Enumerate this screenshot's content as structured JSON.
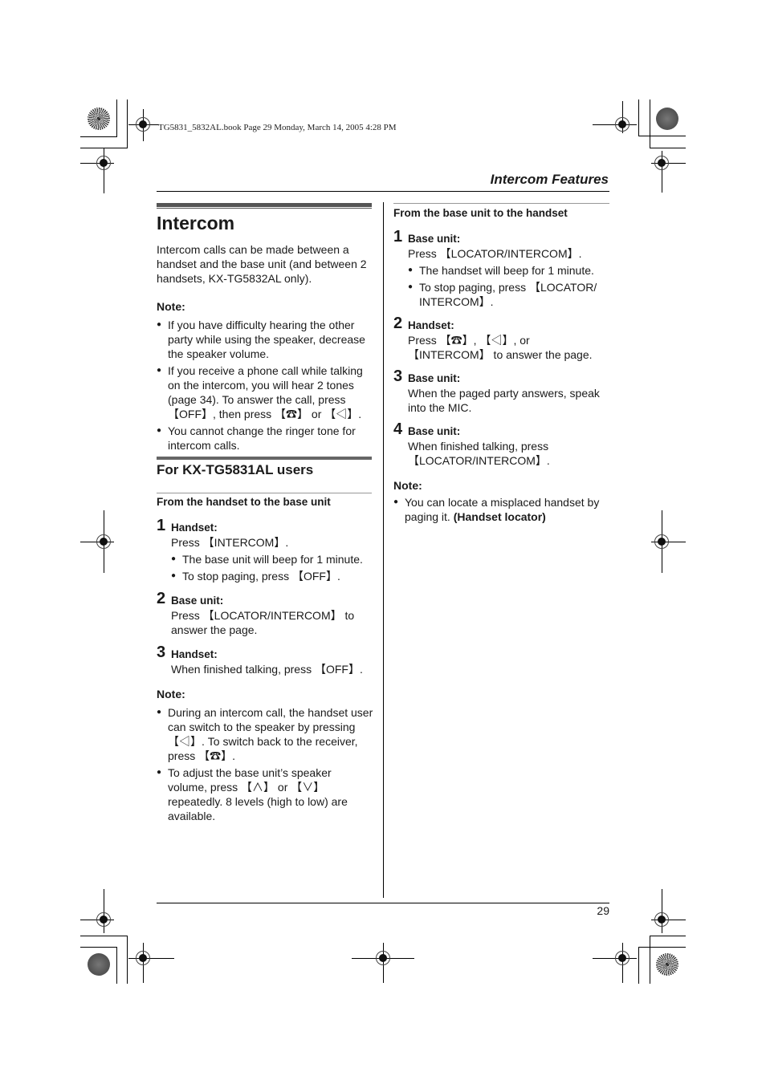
{
  "print_info": "TG5831_5832AL.book  Page 29  Monday, March 14, 2005  4:28 PM",
  "header": {
    "section_title": "Intercom Features"
  },
  "left": {
    "title": "Intercom",
    "intro": "Intercom calls can be made between a handset and the base unit (and between 2 handsets, KX-TG5832AL only).",
    "note1": {
      "label": "Note:",
      "items": [
        "If you have difficulty hearing the other party while using the speaker, decrease the speaker volume.",
        "If you receive a phone call while talking on the intercom, you will hear 2 tones (page 34). To answer the call, press 【OFF】, then press 【☎】 or 【◁】.",
        "You cannot change the ringer tone for intercom calls."
      ]
    },
    "subsection_title": "For KX-TG5831AL users",
    "procedure_title": "From the handset to the base unit",
    "steps": [
      {
        "num": "1",
        "head": "Handset:",
        "text": "Press 【INTERCOM】.",
        "bullets": [
          "The base unit will beep for 1 minute.",
          "To stop paging, press 【OFF】."
        ]
      },
      {
        "num": "2",
        "head": "Base unit:",
        "text": "Press 【LOCATOR/INTERCOM】 to answer the page."
      },
      {
        "num": "3",
        "head": "Handset:",
        "text": "When finished talking, press 【OFF】."
      }
    ],
    "note2": {
      "label": "Note:",
      "items": [
        "During an intercom call, the handset user can switch to the speaker by pressing 【◁】. To switch back to the receiver, press 【☎】.",
        "To adjust the base unit’s speaker volume, press 【∧】 or 【∨】 repeatedly. 8 levels (high to low) are available."
      ]
    }
  },
  "right": {
    "procedure_title": "From the base unit to the handset",
    "steps": [
      {
        "num": "1",
        "head": "Base unit:",
        "text": "Press 【LOCATOR/INTERCOM】.",
        "bullets": [
          "The handset will beep for 1 minute.",
          "To stop paging, press 【LOCATOR/ INTERCOM】."
        ]
      },
      {
        "num": "2",
        "head": "Handset:",
        "text": "Press 【☎】, 【◁】, or 【INTERCOM】 to answer the page."
      },
      {
        "num": "3",
        "head": "Base unit:",
        "text": "When the paged party answers, speak into the MIC."
      },
      {
        "num": "4",
        "head": "Base unit:",
        "text": "When finished talking, press 【LOCATOR/INTERCOM】."
      }
    ],
    "note": {
      "label": "Note:",
      "text": "You can locate a misplaced handset by paging it.",
      "bold_text": "(Handset locator)"
    }
  },
  "footer": {
    "page_number": "29"
  }
}
